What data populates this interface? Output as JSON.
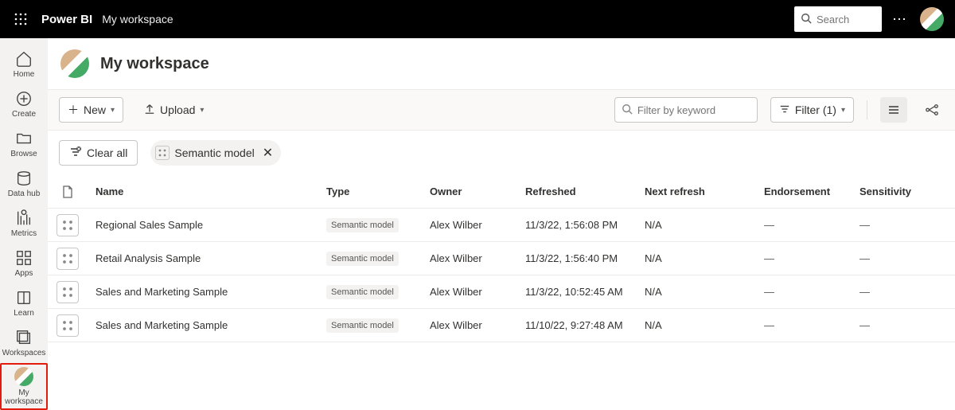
{
  "top": {
    "brand": "Power BI",
    "crumb": "My workspace",
    "search_placeholder": "Search"
  },
  "rail": {
    "home": "Home",
    "create": "Create",
    "browse": "Browse",
    "datahub": "Data hub",
    "metrics": "Metrics",
    "apps": "Apps",
    "learn": "Learn",
    "workspaces": "Workspaces",
    "myworkspace": "My workspace"
  },
  "workspace": {
    "title": "My workspace"
  },
  "toolbar": {
    "new": "New",
    "upload": "Upload",
    "filter_placeholder": "Filter by keyword",
    "filter_label": "Filter (1)"
  },
  "chips": {
    "clear_all": "Clear all",
    "semantic_model": "Semantic model"
  },
  "columns": {
    "name": "Name",
    "type": "Type",
    "owner": "Owner",
    "refreshed": "Refreshed",
    "next_refresh": "Next refresh",
    "endorsement": "Endorsement",
    "sensitivity": "Sensitivity"
  },
  "rows": [
    {
      "name": "Regional Sales Sample",
      "type": "Semantic model",
      "owner": "Alex Wilber",
      "refreshed": "11/3/22, 1:56:08 PM",
      "next": "N/A",
      "endorsement": "—",
      "sensitivity": "—"
    },
    {
      "name": "Retail Analysis Sample",
      "type": "Semantic model",
      "owner": "Alex Wilber",
      "refreshed": "11/3/22, 1:56:40 PM",
      "next": "N/A",
      "endorsement": "—",
      "sensitivity": "—"
    },
    {
      "name": "Sales and Marketing Sample",
      "type": "Semantic model",
      "owner": "Alex Wilber",
      "refreshed": "11/3/22, 10:52:45 AM",
      "next": "N/A",
      "endorsement": "—",
      "sensitivity": "—"
    },
    {
      "name": "Sales and Marketing Sample",
      "type": "Semantic model",
      "owner": "Alex Wilber",
      "refreshed": "11/10/22, 9:27:48 AM",
      "next": "N/A",
      "endorsement": "—",
      "sensitivity": "—"
    }
  ]
}
